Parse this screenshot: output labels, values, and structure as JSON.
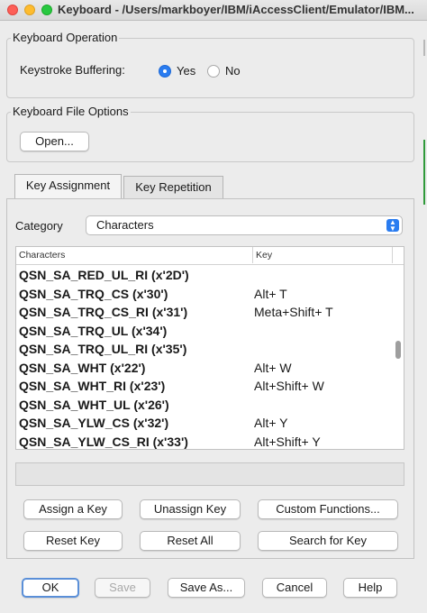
{
  "window": {
    "title": "Keyboard - /Users/markboyer/IBM/iAccessClient/Emulator/IBM..."
  },
  "keyboard_operation": {
    "group_title": "Keyboard Operation",
    "label": "Keystroke Buffering:",
    "options": [
      {
        "label": "Yes",
        "selected": true
      },
      {
        "label": "No",
        "selected": false
      }
    ]
  },
  "keyboard_file": {
    "group_title": "Keyboard File Options",
    "open_button": "Open..."
  },
  "tabs": [
    {
      "label": "Key Assignment",
      "active": true
    },
    {
      "label": "Key Repetition",
      "active": false
    }
  ],
  "category": {
    "label": "Category",
    "value": "Characters"
  },
  "table": {
    "columns": [
      "Characters",
      "Key"
    ],
    "rows": [
      {
        "name": "QSN_SA_RED_UL_RI (x'2D')",
        "key": ""
      },
      {
        "name": "QSN_SA_TRQ_CS (x'30')",
        "key": "Alt+ T"
      },
      {
        "name": "QSN_SA_TRQ_CS_RI (x'31')",
        "key": "Meta+Shift+ T"
      },
      {
        "name": "QSN_SA_TRQ_UL (x'34')",
        "key": ""
      },
      {
        "name": "QSN_SA_TRQ_UL_RI (x'35')",
        "key": ""
      },
      {
        "name": "QSN_SA_WHT (x'22')",
        "key": "Alt+ W"
      },
      {
        "name": "QSN_SA_WHT_RI (x'23')",
        "key": "Alt+Shift+ W"
      },
      {
        "name": "QSN_SA_WHT_UL (x'26')",
        "key": ""
      },
      {
        "name": "QSN_SA_YLW_CS (x'32')",
        "key": "Alt+ Y"
      },
      {
        "name": "QSN_SA_YLW_CS_RI (x'33')",
        "key": "Alt+Shift+ Y"
      }
    ]
  },
  "action_buttons": {
    "assign": "Assign a Key",
    "unassign": "Unassign Key",
    "custom": "Custom Functions...",
    "reset_key": "Reset Key",
    "reset_all": "Reset All",
    "search": "Search for Key"
  },
  "dialog_buttons": {
    "ok": "OK",
    "save": "Save",
    "save_as": "Save As...",
    "cancel": "Cancel",
    "help": "Help"
  },
  "colors": {
    "accent": "#2a7cf0",
    "window_bg": "#ececec"
  }
}
